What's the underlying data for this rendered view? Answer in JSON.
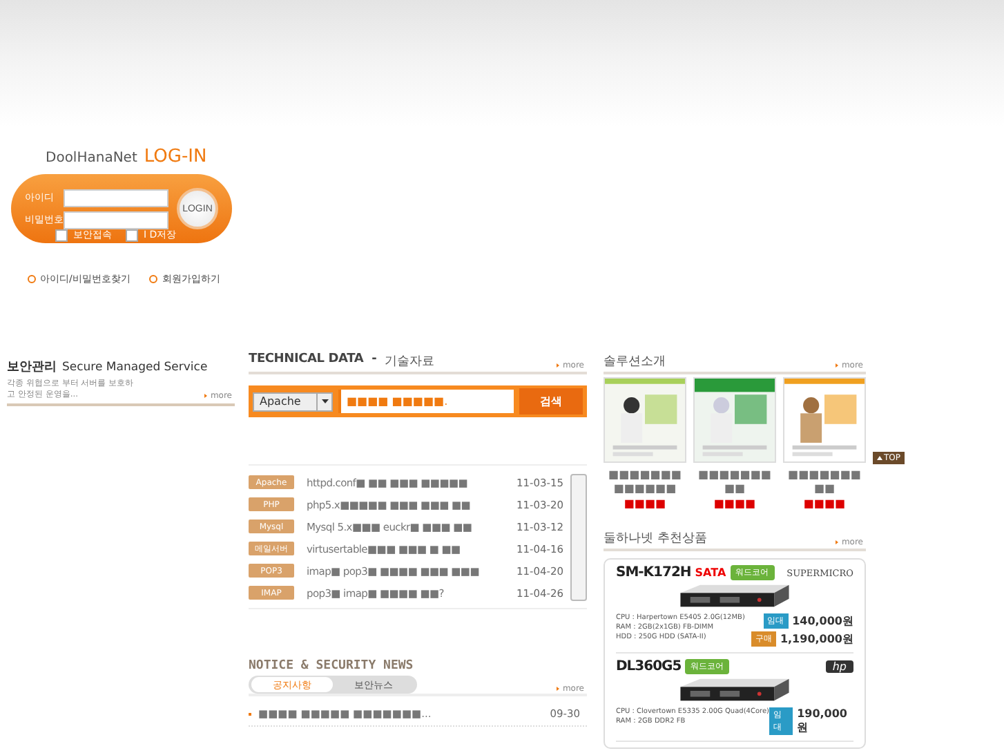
{
  "login": {
    "brand": "DoolHanaNet",
    "title": "LOG-IN",
    "fields": [
      {
        "label": "아이디"
      },
      {
        "label": "비밀번호"
      }
    ],
    "button": "LOGIN",
    "options": [
      {
        "label": "보안접속",
        "checked": false
      },
      {
        "label": "I D저장",
        "checked": false
      }
    ],
    "links": [
      "아이디/비밀번호찾기",
      "회원가입하기"
    ]
  },
  "security_service": {
    "title": "보안관리",
    "subtitle": "Secure Managed Service",
    "description": "각종 위협으로 부터 서버를 보호하고 안정된 운영을...",
    "more": "more"
  },
  "technical_data": {
    "title": "TECHNICAL DATA",
    "separator": "-",
    "title_ko": "기술자료",
    "more": "more",
    "search": {
      "category": "Apache",
      "query": "■■■■ ■■■■■.",
      "button": "검색"
    },
    "rows": [
      {
        "tag": "Apache",
        "title": "httpd.conf■ ■■ ■■■ ■■■■■",
        "date": "11-03-15"
      },
      {
        "tag": "PHP",
        "title": "php5.x■■■■■ ■■■ ■■■ ■■",
        "date": "11-03-20"
      },
      {
        "tag": "Mysql",
        "title": "Mysql 5.x■■■ euckr■ ■■■ ■■",
        "date": "11-03-12"
      },
      {
        "tag": "메일서버",
        "title": "virtusertable■■■ ■■■ ■ ■■",
        "date": "11-04-16"
      },
      {
        "tag": "POP3",
        "title": "imap■ pop3■ ■■■■ ■■■ ■■■",
        "date": "11-04-20"
      },
      {
        "tag": "IMAP",
        "title": "pop3■ imap■ ■■■■ ■■?",
        "date": "11-04-26"
      }
    ]
  },
  "notice": {
    "title": "NOTICE & SECURITY NEWS",
    "tabs": [
      {
        "label": "공지사항",
        "selected": true
      },
      {
        "label": "보안뉴스",
        "selected": false
      }
    ],
    "more": "more",
    "items": [
      {
        "title": "■■■■ ■■■■■ ■■■■■■■...",
        "date": "09-30"
      }
    ]
  },
  "solutions": {
    "title": "솔루션소개",
    "more": "more",
    "items": [
      {
        "name": "■■■■■■■ ■■■■■■",
        "rating": "■■■■"
      },
      {
        "name": "■■■■■■■ ■■",
        "rating": "■■■■"
      },
      {
        "name": "■■■■■■■ ■■",
        "rating": "■■■■"
      }
    ]
  },
  "products": {
    "title": "둘하나넷 추천상품",
    "more": "more",
    "items": [
      {
        "model": "SM-K172H",
        "tag": "SATA",
        "badge": "워드코어",
        "brand": "SUPERMICRO",
        "specs": [
          "CPU : Harpertown E5405 2.0G(12MB)",
          "RAM : 2GB(2x1GB) FB-DIMM",
          "HDD : 250G HDD (SATA-II)"
        ],
        "prices": [
          {
            "kind": "rent",
            "label": "임대",
            "amount": "140,000",
            "unit": "원"
          },
          {
            "kind": "buy",
            "label": "구매",
            "amount": "1,190,000",
            "unit": "원"
          }
        ]
      },
      {
        "model": "DL360G5",
        "badge": "워드코어",
        "brand": "hp",
        "specs": [
          "CPU : Clovertown E5335 2.00G Quad(4Core)",
          "RAM : 2GB DDR2 FB"
        ],
        "prices": [
          {
            "kind": "rent",
            "label": "임대",
            "amount": "190,000",
            "unit": "원"
          }
        ]
      }
    ]
  },
  "top_button": "TOP"
}
